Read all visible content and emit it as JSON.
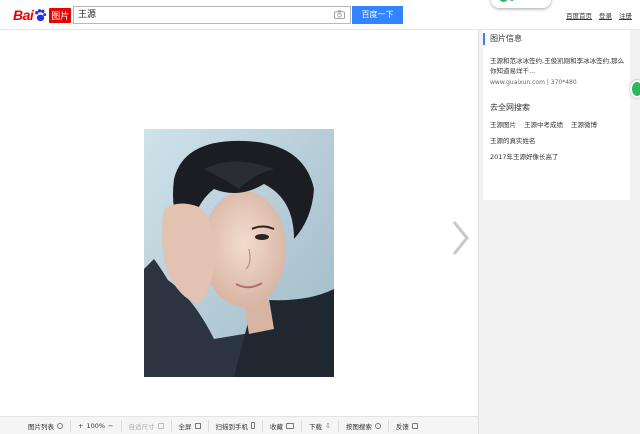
{
  "header": {
    "logo_text": "Bai",
    "logo_tag": "图片",
    "search_value": "王源",
    "search_button": "百度一下",
    "links": [
      "百度首页",
      "登录",
      "注册"
    ]
  },
  "viewer": {
    "image_alt": "王源"
  },
  "sidepanel": {
    "info_title": "图片信息",
    "info_text": "王源和范冰冰签约,王俊凯刚和李冰冰签约,那么你知道易烊千...",
    "info_source": "www.guaixun.com",
    "info_size": "370*480",
    "search_title": "去全网搜索",
    "related": [
      [
        "王源图片",
        "王源中考成绩",
        "王源微博"
      ],
      [
        "王源的真实姓名"
      ],
      [
        "2017年王源好像长高了"
      ]
    ]
  },
  "toolbar": {
    "list": "图片列表",
    "zoom_in": "+",
    "zoom": "100%",
    "zoom_out": "−",
    "fit": "自适尺寸",
    "fullscreen": "全屏",
    "scan_phone": "扫描到手机",
    "favorite": "收藏",
    "download": "下载",
    "image_search": "按图搜索",
    "feedback": "反馈"
  },
  "colors": {
    "brand_red": "#e10601",
    "accent_blue": "#3385ff",
    "green": "#2fb760"
  }
}
